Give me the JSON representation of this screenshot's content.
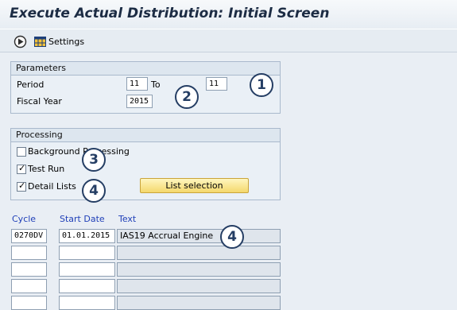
{
  "window": {
    "title": "Execute Actual Distribution: Initial Screen"
  },
  "toolbar": {
    "execute_icon": "execute-clock-icon",
    "settings_icon": "settings-grid-icon",
    "settings_label": "Settings"
  },
  "parameters": {
    "header": "Parameters",
    "period_label": "Period",
    "period_from": "11",
    "to_label": "To",
    "period_to": "11",
    "fiscal_year_label": "Fiscal Year",
    "fiscal_year": "2015"
  },
  "processing": {
    "header": "Processing",
    "background_label": "Background Processing",
    "background_checked": false,
    "test_run_label": "Test Run",
    "test_run_checked": true,
    "detail_lists_label": "Detail Lists",
    "detail_lists_checked": true,
    "list_selection_button": "List selection"
  },
  "table": {
    "headers": [
      "Cycle",
      "Start Date",
      "Text"
    ],
    "rows": [
      [
        "0270DV",
        "01.01.2015",
        "IAS19 Accrual Engine"
      ],
      [
        "",
        "",
        ""
      ],
      [
        "",
        "",
        ""
      ],
      [
        "",
        "",
        ""
      ],
      [
        "",
        "",
        ""
      ]
    ]
  },
  "callouts": [
    "1",
    "2",
    "3",
    "4",
    "4"
  ],
  "colors": {
    "accent_button": "#f4d86c",
    "column_header_text": "#1f3fb8",
    "callout_border": "#253e64"
  }
}
